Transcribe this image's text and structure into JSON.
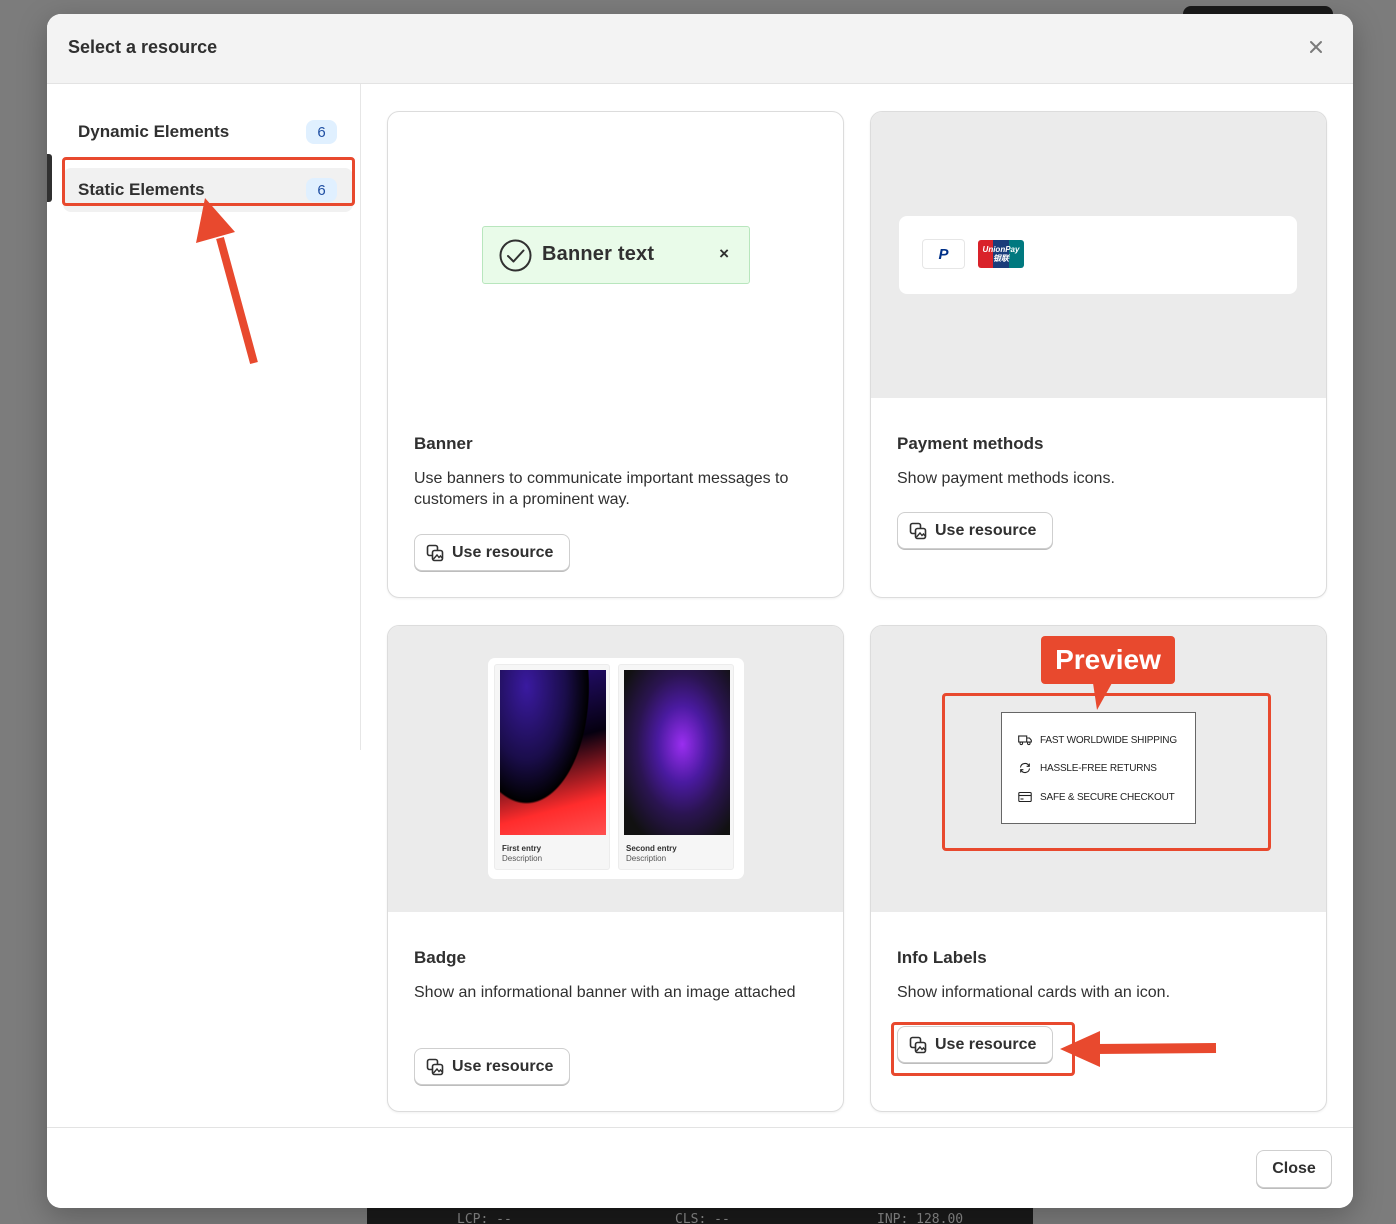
{
  "modal": {
    "title": "Select a resource",
    "close_button": "Close"
  },
  "sidebar": {
    "items": [
      {
        "label": "Dynamic Elements",
        "count": "6",
        "active": false
      },
      {
        "label": "Static Elements",
        "count": "6",
        "active": true
      }
    ]
  },
  "cards": [
    {
      "title": "Banner",
      "description": "Use banners to communicate important messages to customers in a prominent way.",
      "button": "Use resource",
      "preview": {
        "banner_text": "Banner text",
        "close_glyph": "×"
      }
    },
    {
      "title": "Payment methods",
      "description": "Show payment methods icons.",
      "button": "Use resource",
      "preview": {
        "icons": [
          "paypal-icon",
          "unionpay-icon"
        ],
        "paypal_glyph": "P",
        "unionpay_text": "UnionPay 银联"
      }
    },
    {
      "title": "Badge",
      "description": "Show an informational banner with an image attached",
      "button": "Use resource",
      "preview": {
        "entries": [
          {
            "title": "First entry",
            "description": "Description"
          },
          {
            "title": "Second entry",
            "description": "Description"
          }
        ]
      }
    },
    {
      "title": "Info Labels",
      "description": "Show informational cards with an icon.",
      "button": "Use resource",
      "preview": {
        "labels": [
          {
            "icon": "truck-icon",
            "text": "FAST WORLDWIDE SHIPPING"
          },
          {
            "icon": "refresh-icon",
            "text": "HASSLE-FREE RETURNS"
          },
          {
            "icon": "credit-card-icon",
            "text": "SAFE & SECURE CHECKOUT"
          }
        ]
      }
    }
  ],
  "annotations": {
    "preview_label": "Preview",
    "color": "#e8492e"
  },
  "background": {
    "metrics": [
      "LCP: --",
      "CLS: --",
      "INP: 128.00"
    ]
  }
}
